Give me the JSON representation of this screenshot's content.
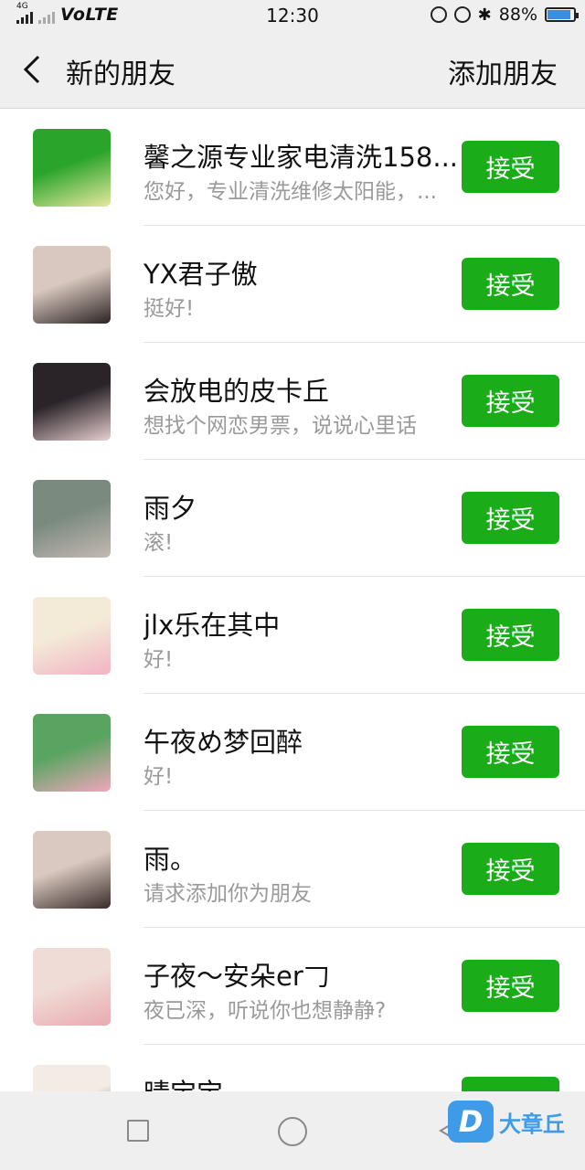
{
  "status_bar": {
    "network": "4G",
    "volte": "VoLTE",
    "time": "12:30",
    "battery": "88%",
    "battery_level": 0.88,
    "icons": [
      "signal-icon",
      "lock-rotation-icon",
      "alarm-icon",
      "bluetooth-icon",
      "battery-icon"
    ]
  },
  "header": {
    "title": "新的朋友",
    "add_friend": "添加朋友"
  },
  "requests": [
    {
      "name": "馨之源专业家电清洗158...",
      "message": "您好，专业清洗维修太阳能，...",
      "accept": "接受",
      "avatar_colors": [
        "#2aa42a",
        "#e8e8a0"
      ]
    },
    {
      "name": "YX君子傲",
      "message": "挺好!",
      "accept": "接受",
      "avatar_colors": [
        "#d8c8bf",
        "#2b2323"
      ]
    },
    {
      "name": "会放电的皮卡丘",
      "message": "想找个网恋男票，说说心里话",
      "accept": "接受",
      "avatar_colors": [
        "#2a2428",
        "#e7cfd0"
      ]
    },
    {
      "name": "雨夕",
      "message": "滚!",
      "accept": "接受",
      "avatar_colors": [
        "#7a8a7f",
        "#c4b9b3"
      ]
    },
    {
      "name": "jlx乐在其中",
      "message": "好!",
      "accept": "接受",
      "avatar_colors": [
        "#f4ead8",
        "#f1b3c4"
      ]
    },
    {
      "name": "午夜め梦回醉",
      "message": "好!",
      "accept": "接受",
      "avatar_colors": [
        "#58a460",
        "#f0a7bd"
      ]
    },
    {
      "name": "雨。",
      "message": "请求添加你为朋友",
      "accept": "接受",
      "avatar_colors": [
        "#d9c9c0",
        "#3a2b2a"
      ]
    },
    {
      "name": "子夜～安朵er𠃌",
      "message": "夜已深，听说你也想静静?",
      "accept": "接受",
      "avatar_colors": [
        "#f0dcd7",
        "#e9a9b0"
      ]
    },
    {
      "name": "晴宝宝",
      "message": "",
      "accept": "接受",
      "avatar_colors": [
        "#f2ebe6",
        "#3a2a25"
      ]
    }
  ],
  "nav": {
    "watermark_badge": "D",
    "watermark_text": "大章丘"
  },
  "colors": {
    "accent": "#1aad19",
    "header_bg": "#efefef",
    "secondary_text": "#9a9a9a"
  }
}
